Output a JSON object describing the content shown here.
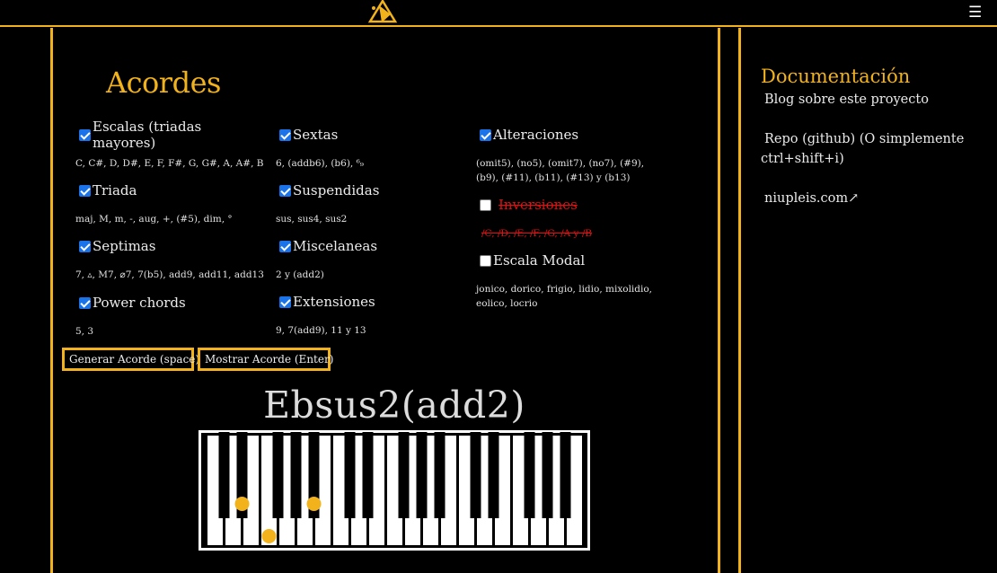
{
  "header": {
    "logo_icon": "triangle-logo-icon",
    "menu_icon": "☰"
  },
  "main": {
    "title": "Acordes",
    "options": [
      {
        "id": "escalas",
        "label": "Escalas (triadas mayores)",
        "checked": true,
        "desc": "C, C#, D, D#, E, F, F#, G, G#, A, A#, B"
      },
      {
        "id": "triada",
        "label": "Triada",
        "checked": true,
        "desc": "maj, M, m, -, aug, +, (#5), dim, °"
      },
      {
        "id": "septimas",
        "label": "Septimas",
        "checked": true,
        "desc": "7, ▵, M7, ⌀7, 7(b5), add9, add11, add13"
      },
      {
        "id": "power",
        "label": "Power chords",
        "checked": true,
        "desc": "5, 3"
      },
      {
        "id": "sextas",
        "label": "Sextas",
        "checked": true,
        "desc": "6, (addb6), (b6), ⁶₉"
      },
      {
        "id": "suspendidas",
        "label": "Suspendidas",
        "checked": true,
        "desc": "sus, sus4, sus2"
      },
      {
        "id": "miscelaneas",
        "label": "Miscelaneas",
        "checked": true,
        "desc": "2 y (add2)"
      },
      {
        "id": "extensiones",
        "label": "Extensiones",
        "checked": true,
        "desc": "9, 7(add9), 11 y 13"
      },
      {
        "id": "alteraciones",
        "label": "Alteraciones",
        "checked": true,
        "desc": "(omit5), (no5), (omit7), (no7), (#9), (b9), (#11), (b11), (#13) y (b13)"
      },
      {
        "id": "inversiones",
        "label": "Inversiones",
        "checked": false,
        "desc": "/C, /D, /E, /F, /G, /A y /B"
      },
      {
        "id": "modal",
        "label": "Escala Modal",
        "checked": false,
        "desc": "jonico, dorico, frigio, lidio, mixolidio, eolico, locrio"
      }
    ],
    "buttons": {
      "generate": "Generar Acorde (space)",
      "show": "Mostrar Acorde (Enter)"
    },
    "chord": "Ebsus2(add2)",
    "piano": {
      "highlight_color": "#f1b21b",
      "highlighted_keys": [
        "Eb",
        "F",
        "Bb"
      ]
    }
  },
  "sidebar": {
    "title": "Documentación",
    "links": [
      "Blog sobre este proyecto",
      "Repo (github) (O simplemente ctrl+shift+i)",
      "niupleis.com↗"
    ]
  },
  "colors": {
    "accent": "#f1b21b",
    "background": "#000000",
    "struck": "#e01010"
  }
}
